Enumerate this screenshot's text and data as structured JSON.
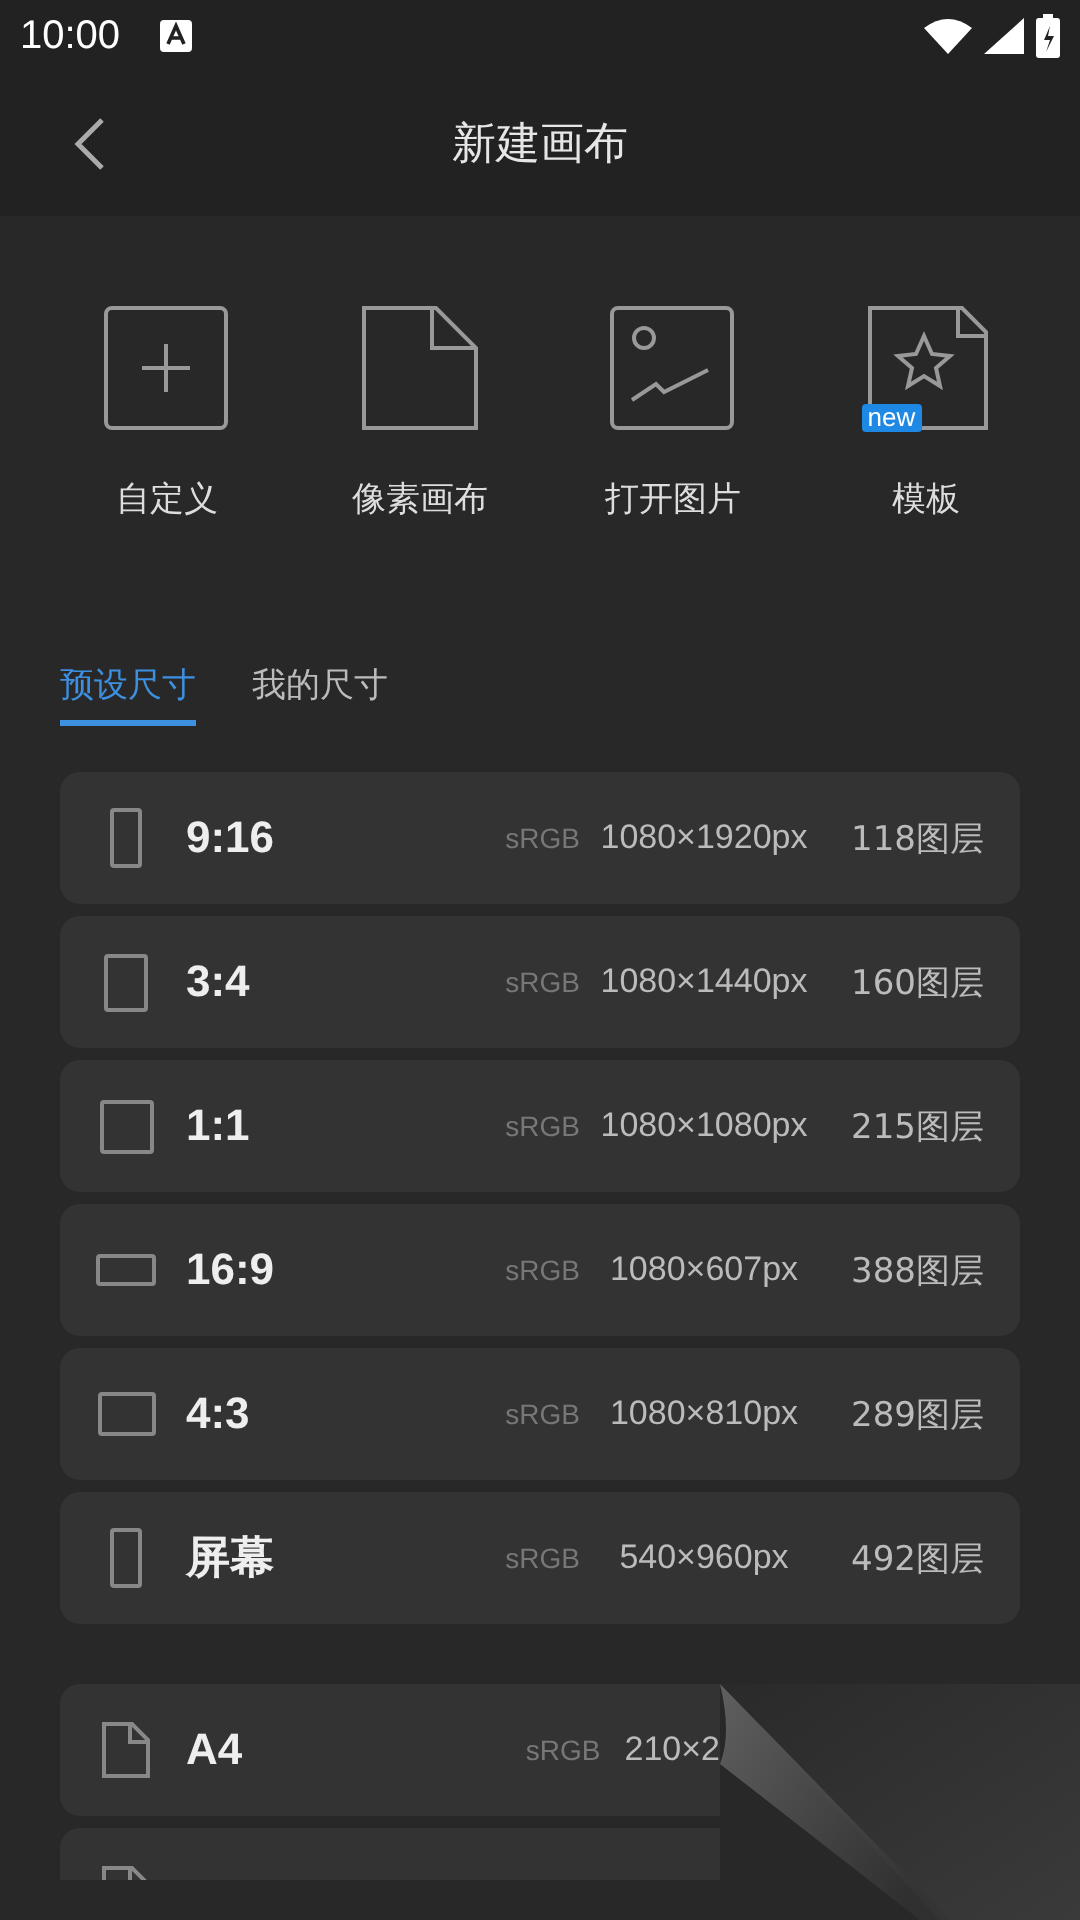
{
  "status_bar": {
    "time": "10:00"
  },
  "header": {
    "title": "新建画布"
  },
  "actions": [
    {
      "kind": "custom",
      "label": "自定义"
    },
    {
      "kind": "pixel",
      "label": "像素画布"
    },
    {
      "kind": "image",
      "label": "打开图片"
    },
    {
      "kind": "template",
      "label": "模板",
      "badge": "new"
    }
  ],
  "tabs": [
    {
      "label": "预设尺寸",
      "selected": true
    },
    {
      "label": "我的尺寸",
      "selected": false
    }
  ],
  "sizes": [
    {
      "kind": "tall",
      "name": "9:16",
      "color_space": "sRGB",
      "dimensions": "1080×1920px",
      "layers": "118图层"
    },
    {
      "kind": "portrait",
      "name": "3:4",
      "color_space": "sRGB",
      "dimensions": "1080×1440px",
      "layers": "160图层"
    },
    {
      "kind": "square",
      "name": "1:1",
      "color_space": "sRGB",
      "dimensions": "1080×1080px",
      "layers": "215图层"
    },
    {
      "kind": "wide",
      "name": "16:9",
      "color_space": "sRGB",
      "dimensions": "1080×607px",
      "layers": "388图层"
    },
    {
      "kind": "landscape",
      "name": "4:3",
      "color_space": "sRGB",
      "dimensions": "1080×810px",
      "layers": "289图层"
    },
    {
      "kind": "tall",
      "name": "屏幕",
      "color_space": "sRGB",
      "dimensions": "540×960px",
      "layers": "492图层"
    },
    {
      "kind": "page",
      "name": "A4",
      "color_space": "sRGB",
      "dimensions": "210×2"
    },
    {
      "kind": "page"
    }
  ]
}
